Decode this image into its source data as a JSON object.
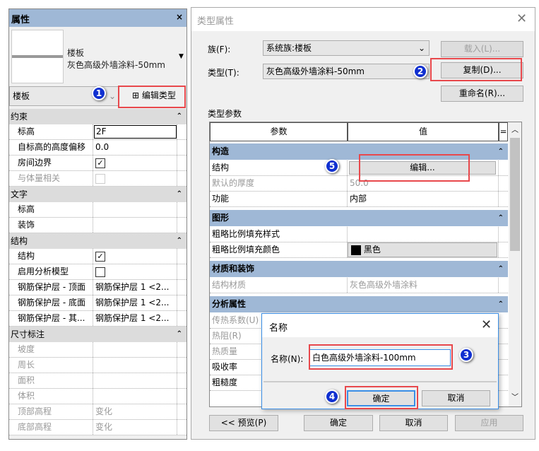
{
  "colors": {
    "section_blue": "#9fb8d6",
    "highlight_red": "#e8484c",
    "badge_blue": "#1030d0"
  },
  "props": {
    "title": "属性",
    "close": "×",
    "type_family": "楼板",
    "type_name": "灰色高级外墙涂料-50mm",
    "selector": "楼板",
    "edit_type": "编辑类型",
    "rows": [
      {
        "k": "sec",
        "name": "约束"
      },
      {
        "name": "标高",
        "value": "2F",
        "input": true
      },
      {
        "name": "自标高的高度偏移",
        "value": "0.0"
      },
      {
        "name": "房间边界",
        "check": true
      },
      {
        "name": "与体量相关",
        "check": false,
        "disabled": true
      },
      {
        "k": "sec",
        "name": "文字"
      },
      {
        "name": "标高",
        "value": ""
      },
      {
        "name": "装饰",
        "value": ""
      },
      {
        "k": "sec",
        "name": "结构"
      },
      {
        "name": "结构",
        "check": true
      },
      {
        "name": "启用分析模型",
        "check": false
      },
      {
        "name": "钢筋保护层 - 顶面",
        "value": "钢筋保护层 1 <2..."
      },
      {
        "name": "钢筋保护层 - 底面",
        "value": "钢筋保护层 1 <2..."
      },
      {
        "name": "钢筋保护层 - 其...",
        "value": "钢筋保护层 1 <2..."
      },
      {
        "k": "sec",
        "name": "尺寸标注"
      },
      {
        "name": "坡度",
        "value": "",
        "disabled": true
      },
      {
        "name": "周长",
        "value": "",
        "disabled": true
      },
      {
        "name": "面积",
        "value": "",
        "disabled": true
      },
      {
        "name": "体积",
        "value": "",
        "disabled": true
      },
      {
        "name": "顶部高程",
        "value": "变化",
        "disabled": true
      },
      {
        "name": "底部高程",
        "value": "变化",
        "disabled": true
      }
    ]
  },
  "type_dialog": {
    "title": "类型属性",
    "family_label": "族(F):",
    "family_value": "系统族:楼板",
    "type_label": "类型(T):",
    "type_value": "灰色高级外墙涂料-50mm",
    "load": "载入(L)...",
    "duplicate": "复制(D)...",
    "rename": "重命名(R)...",
    "params_label": "类型参数",
    "col_param": "参数",
    "col_value": "值",
    "col_eq": "=",
    "rows": [
      {
        "k": "sec",
        "name": "构造"
      },
      {
        "name": "结构",
        "button": "编辑..."
      },
      {
        "name": "默认的厚度",
        "value": "50.0",
        "disabled": true
      },
      {
        "name": "功能",
        "value": "内部"
      },
      {
        "k": "sec",
        "name": "图形"
      },
      {
        "name": "粗略比例填充样式",
        "value": ""
      },
      {
        "name": "粗略比例填充颜色",
        "color": "黑色",
        "swatch": "#000000"
      },
      {
        "k": "sec",
        "name": "材质和装饰"
      },
      {
        "name": "结构材质",
        "value": "灰色高级外墙涂料",
        "disabled": true
      },
      {
        "k": "sec",
        "name": "分析属性"
      },
      {
        "name": "传热系数(U)",
        "value": "",
        "disabled": true
      },
      {
        "name": "热阻(R)",
        "value": "",
        "disabled": true
      },
      {
        "name": "热质量",
        "value": "",
        "disabled": true
      },
      {
        "name": "吸收率",
        "value": ""
      },
      {
        "name": "粗糙度",
        "value": ""
      }
    ],
    "preview": "<< 预览(P)",
    "ok": "确定",
    "cancel": "取消",
    "apply": "应用"
  },
  "name_dialog": {
    "title": "名称",
    "label": "名称(N):",
    "value": "白色高级外墙涂料-100mm",
    "ok": "确定",
    "cancel": "取消"
  },
  "badges": [
    "1",
    "2",
    "3",
    "4",
    "5"
  ]
}
